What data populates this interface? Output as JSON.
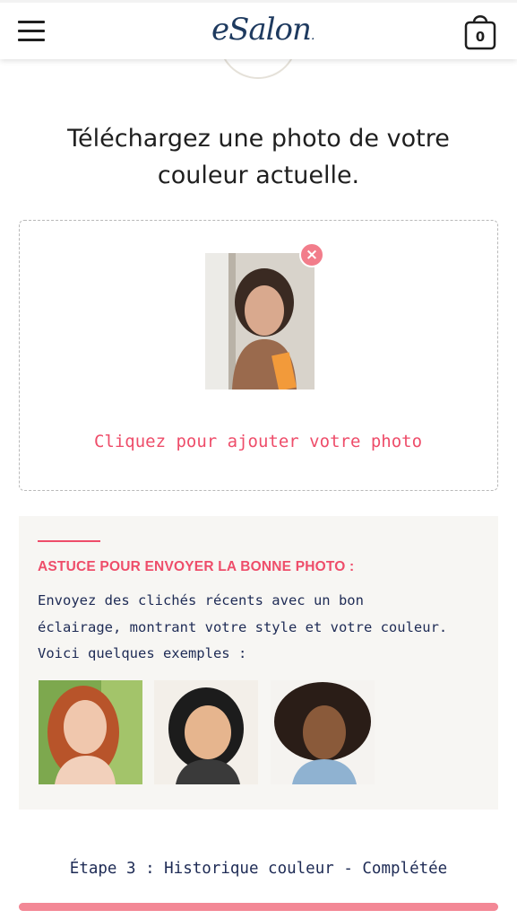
{
  "header": {
    "logo_text": "eSalon",
    "logo_mark": ".",
    "cart_count": "0",
    "menu_icon": "hamburger-icon",
    "cart_icon": "shopping-bag-icon"
  },
  "upload": {
    "title": "Téléchargez une photo de votre couleur actuelle.",
    "add_link": "Cliquez pour ajouter votre photo",
    "remove_icon": "close-icon"
  },
  "tip": {
    "heading": "ASTUCE POUR ENVOYER LA BONNE PHOTO :",
    "text": "Envoyez des clichés récents avec un bon éclairage, montrant votre style et votre couleur. Voici quelques exemples :"
  },
  "step": {
    "label": "Étape 3 : Historique couleur - Complétée",
    "progress": 1.0
  },
  "colors": {
    "accent": "#ee4d6a",
    "navy": "#1e2b55",
    "progress": "#f38896",
    "tip_bg": "#f7f6f3"
  }
}
